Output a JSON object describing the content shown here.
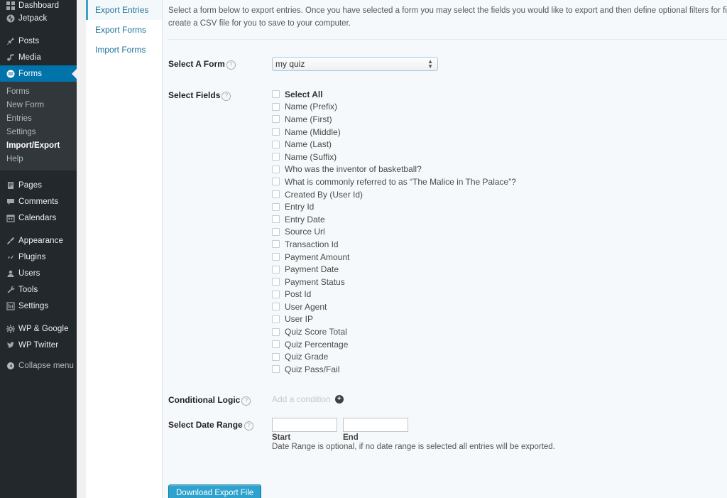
{
  "admin_menu": {
    "items": [
      {
        "label": "Dashboard",
        "icon": "dashboard-icon",
        "current": false,
        "clipped": true
      },
      {
        "label": "Jetpack",
        "icon": "jetpack-icon",
        "current": false
      },
      {
        "sep": true
      },
      {
        "label": "Posts",
        "icon": "pin-icon",
        "current": false
      },
      {
        "label": "Media",
        "icon": "media-icon",
        "current": false
      },
      {
        "label": "Forms",
        "icon": "forms-icon",
        "current": true
      }
    ],
    "submenu": [
      {
        "label": "Forms",
        "current": false
      },
      {
        "label": "New Form",
        "current": false
      },
      {
        "label": "Entries",
        "current": false
      },
      {
        "label": "Settings",
        "current": false
      },
      {
        "label": "Import/Export",
        "current": true
      },
      {
        "label": "Help",
        "current": false
      }
    ],
    "items_after": [
      {
        "label": "Pages",
        "icon": "pages-icon"
      },
      {
        "label": "Comments",
        "icon": "comments-icon"
      },
      {
        "label": "Calendars",
        "icon": "calendar-icon"
      },
      {
        "sep": true
      },
      {
        "label": "Appearance",
        "icon": "brush-icon"
      },
      {
        "label": "Plugins",
        "icon": "plugin-icon"
      },
      {
        "label": "Users",
        "icon": "users-icon"
      },
      {
        "label": "Tools",
        "icon": "tools-icon"
      },
      {
        "label": "Settings",
        "icon": "settings-icon"
      },
      {
        "sep": true
      },
      {
        "label": "WP & Google",
        "icon": "gear-icon"
      },
      {
        "label": "WP Twitter",
        "icon": "twitter-icon"
      }
    ],
    "collapse": {
      "label": "Collapse menu",
      "icon": "collapse-icon"
    }
  },
  "gf_nav": {
    "tabs": [
      {
        "label": "Export Entries",
        "active": true
      },
      {
        "label": "Export Forms",
        "active": false
      },
      {
        "label": "Import Forms",
        "active": false
      }
    ]
  },
  "main": {
    "intro_line1": "Select a form below to export entries. Once you have selected a form you may select the fields you would like to export and then define optional filters for field values and the date range. When y",
    "intro_line2": "create a CSV file for you to save to your computer.",
    "select_form": {
      "label": "Select A Form",
      "help": "?",
      "value": "my quiz",
      "options": [
        "my quiz"
      ]
    },
    "select_fields": {
      "label": "Select Fields",
      "help": "?",
      "items": [
        {
          "label": "Select All",
          "checked": false,
          "bold": true
        },
        {
          "label": "Name (Prefix)",
          "checked": false
        },
        {
          "label": "Name (First)",
          "checked": false
        },
        {
          "label": "Name (Middle)",
          "checked": false
        },
        {
          "label": "Name (Last)",
          "checked": false
        },
        {
          "label": "Name (Suffix)",
          "checked": false
        },
        {
          "label": "Who was the inventor of basketball?",
          "checked": false
        },
        {
          "label": "What is commonly referred to as “The Malice in The Palace”?",
          "checked": false
        },
        {
          "label": "Created By (User Id)",
          "checked": false
        },
        {
          "label": "Entry Id",
          "checked": false
        },
        {
          "label": "Entry Date",
          "checked": false
        },
        {
          "label": "Source Url",
          "checked": false
        },
        {
          "label": "Transaction Id",
          "checked": false
        },
        {
          "label": "Payment Amount",
          "checked": false
        },
        {
          "label": "Payment Date",
          "checked": false
        },
        {
          "label": "Payment Status",
          "checked": false
        },
        {
          "label": "Post Id",
          "checked": false
        },
        {
          "label": "User Agent",
          "checked": false
        },
        {
          "label": "User IP",
          "checked": false
        },
        {
          "label": "Quiz Score Total",
          "checked": false
        },
        {
          "label": "Quiz Percentage",
          "checked": false
        },
        {
          "label": "Quiz Grade",
          "checked": false
        },
        {
          "label": "Quiz Pass/Fail",
          "checked": false
        }
      ]
    },
    "conditional_logic": {
      "label": "Conditional Logic",
      "help": "?",
      "add_text": "Add a condition",
      "plus": "+"
    },
    "date_range": {
      "label": "Select Date Range",
      "help": "?",
      "start_value": "",
      "end_value": "",
      "start_label": "Start",
      "end_label": "End",
      "note": "Date Range is optional, if no date range is selected all entries will be exported."
    },
    "submit_label": "Download Export File"
  },
  "colors": {
    "admin_bg": "#23282d",
    "submenu_bg": "#32373c",
    "accent_blue": "#0073aa",
    "button_blue": "#2ea2cc",
    "link_blue": "#21759b",
    "panel_bg": "#f6f9fb"
  }
}
